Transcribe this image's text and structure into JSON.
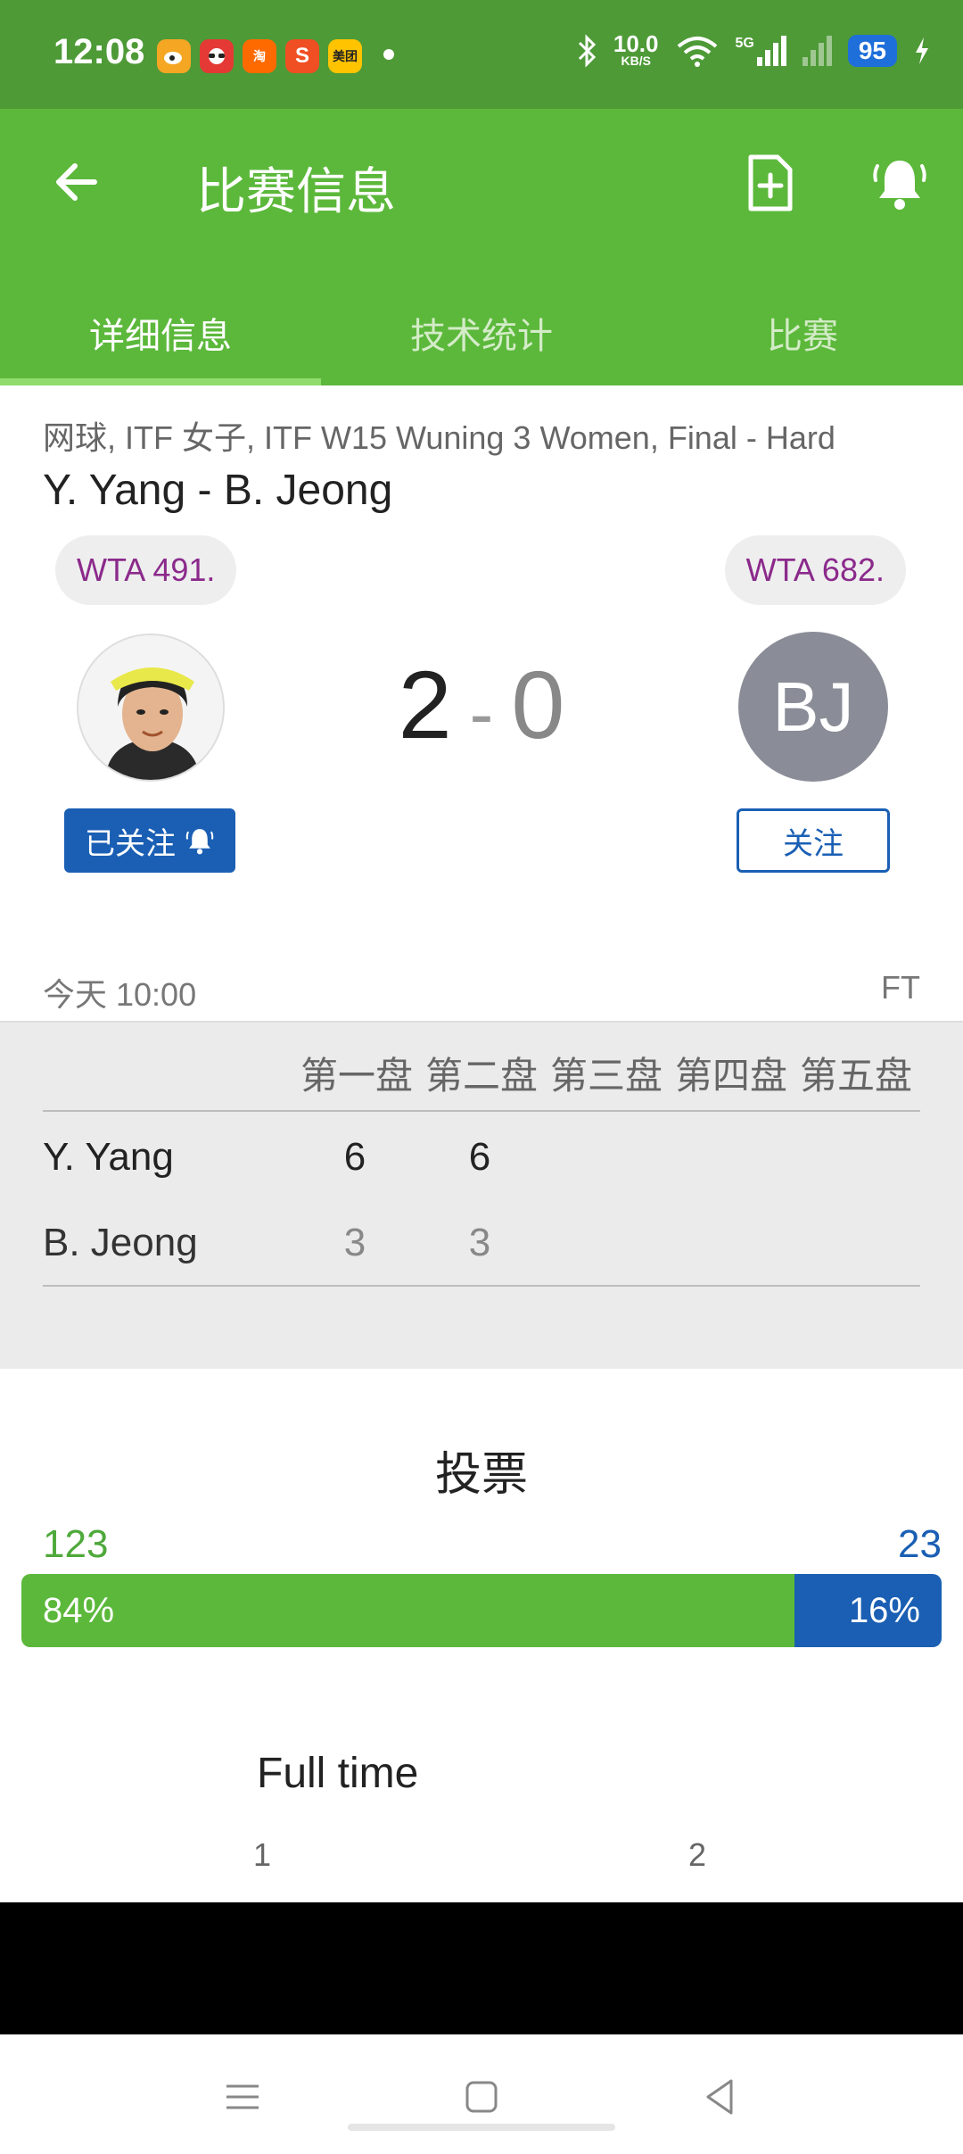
{
  "status_bar": {
    "time": "12:08",
    "app_icons": [
      {
        "name": "weibo-icon",
        "color": "#f5a623",
        "text": ""
      },
      {
        "name": "sunglasses-app-icon",
        "color": "#e53935",
        "text": ""
      },
      {
        "name": "taobao-icon",
        "color": "#ff6a00",
        "text": "淘"
      },
      {
        "name": "sogou-icon",
        "color": "#f04e23",
        "text": "S"
      },
      {
        "name": "meituan-icon",
        "color": "#ffc300",
        "text": "美团"
      }
    ],
    "net_speed": "10.0",
    "net_unit": "KB/S",
    "network": "5G",
    "battery": "95",
    "colors": {
      "background": "#4e9a37"
    }
  },
  "app_bar": {
    "title": "比赛信息",
    "tabs": [
      {
        "label": "详细信息",
        "active": true
      },
      {
        "label": "技术统计",
        "active": false
      },
      {
        "label": "比赛",
        "active": false
      }
    ],
    "colors": {
      "background": "#5cb83b",
      "indicator": "#8fdc6c"
    }
  },
  "match": {
    "breadcrumb": "网球, ITF 女子, ITF W15 Wuning 3 Women, Final - Hard",
    "title": "Y. Yang - B. Jeong",
    "home": {
      "name": "Y. Yang",
      "rank": "WTA 491.",
      "follow_label": "已关注"
    },
    "away": {
      "name": "B. Jeong",
      "rank": "WTA 682.",
      "initials": "BJ",
      "follow_label": "关注"
    },
    "score": {
      "home": "2",
      "separator": "-",
      "away": "0"
    },
    "start_time": "今天 10:00",
    "status": "FT"
  },
  "sets": {
    "headers": [
      "第一盘",
      "第二盘",
      "第三盘",
      "第四盘",
      "第五盘"
    ],
    "rows": [
      {
        "name": "Y. Yang",
        "values": [
          "6",
          "6"
        ]
      },
      {
        "name": "B. Jeong",
        "values": [
          "3",
          "3"
        ]
      }
    ]
  },
  "vote": {
    "title": "投票",
    "home_count": "123",
    "away_count": "23",
    "home_percent_label": "84%",
    "away_percent_label": "16%",
    "home_fraction": 0.84,
    "colors": {
      "home": "#5cb83b",
      "away": "#1a5fb4"
    }
  },
  "full_time": {
    "title": "Full time",
    "columns": [
      "1",
      "2"
    ]
  }
}
